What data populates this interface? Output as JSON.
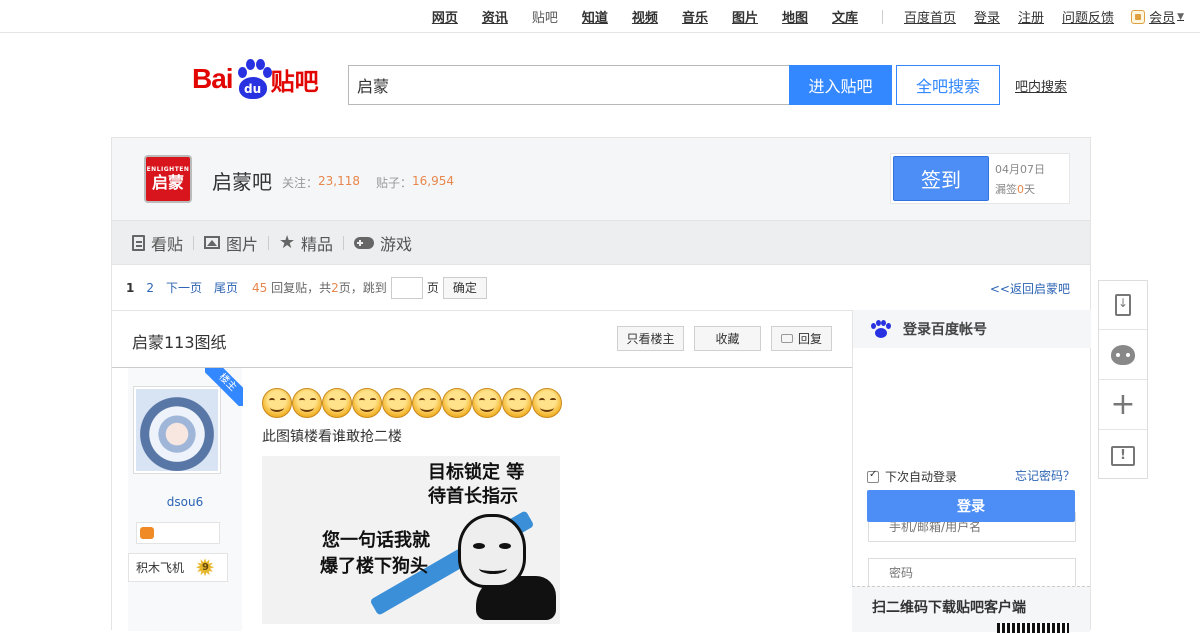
{
  "topnav": {
    "links": [
      {
        "label": "网页",
        "style": "bold"
      },
      {
        "label": "资讯",
        "style": "bold"
      },
      {
        "label": "贴吧",
        "style": "plain"
      },
      {
        "label": "知道",
        "style": "bold"
      },
      {
        "label": "视频",
        "style": "bold"
      },
      {
        "label": "音乐",
        "style": "bold"
      },
      {
        "label": "图片",
        "style": "bold"
      },
      {
        "label": "地图",
        "style": "bold"
      },
      {
        "label": "文库",
        "style": "bold"
      }
    ],
    "user_links": [
      "百度首页",
      "登录",
      "注册",
      "问题反馈"
    ],
    "member_label": "会员"
  },
  "header": {
    "logo_bai": "Bai",
    "logo_du": "du",
    "logo_tieba": "贴吧",
    "search_value": "启蒙",
    "enter_button": "进入贴吧",
    "all_search_button": "全吧搜索",
    "inbar_search": "吧内搜索"
  },
  "forum": {
    "logo_en": "ENLIGHTEN",
    "logo_cn": "启蒙",
    "name": "启蒙吧",
    "follow_label": "关注：",
    "follow_count": "23,118",
    "posts_label": "贴子：",
    "posts_count": "16,954",
    "sign_button": "签到",
    "sign_date": "04月07日",
    "missed_prefix": "漏签",
    "missed_count": "0",
    "missed_suffix": "天",
    "tabs": [
      {
        "label": "看贴",
        "icon": "document-icon"
      },
      {
        "label": "图片",
        "icon": "image-icon"
      },
      {
        "label": "精品",
        "icon": "star-icon"
      },
      {
        "label": "游戏",
        "icon": "gamepad-icon"
      }
    ]
  },
  "pager": {
    "pages": [
      "1",
      "2"
    ],
    "next": "下一页",
    "last": "尾页",
    "reply_count": "45",
    "reply_text": "回复贴，共",
    "total_pages": "2",
    "pages_text": "页，跳到",
    "page_unit": "页",
    "jump_value": "",
    "confirm": "确定",
    "back_link": "<<返回启蒙吧"
  },
  "thread": {
    "title": "启蒙113图纸",
    "only_author_button": "只看楼主",
    "favorite_button": "收藏",
    "reply_button": "回复"
  },
  "post": {
    "author_ribbon": "楼主",
    "author_name": "dsou6",
    "level_title": "积木飞机",
    "level_number": "9",
    "emoji_count": 10,
    "text": "此图镇楼看谁敢抢二楼",
    "meme_lines": [
      "目标锁定 等",
      "待首长指示",
      "您一句话我就",
      "爆了楼下狗头"
    ]
  },
  "login": {
    "title": "登录百度帐号",
    "username_placeholder": "手机/邮箱/用户名",
    "password_placeholder": "密码",
    "auto_login": "下次自动登录",
    "forgot": "忘记密码？",
    "login_button": "登录",
    "qr_title": "扫二维码下载贴吧客户端"
  },
  "float_bar": {
    "items": [
      "download-app-icon",
      "bear-icon",
      "plus-icon",
      "feedback-icon"
    ]
  },
  "colors": {
    "brand_red": "#e10602",
    "brand_blue": "#2932e1",
    "accent_blue": "#3388ff",
    "link_blue": "#2d64b3",
    "count_orange": "#e7874d"
  }
}
